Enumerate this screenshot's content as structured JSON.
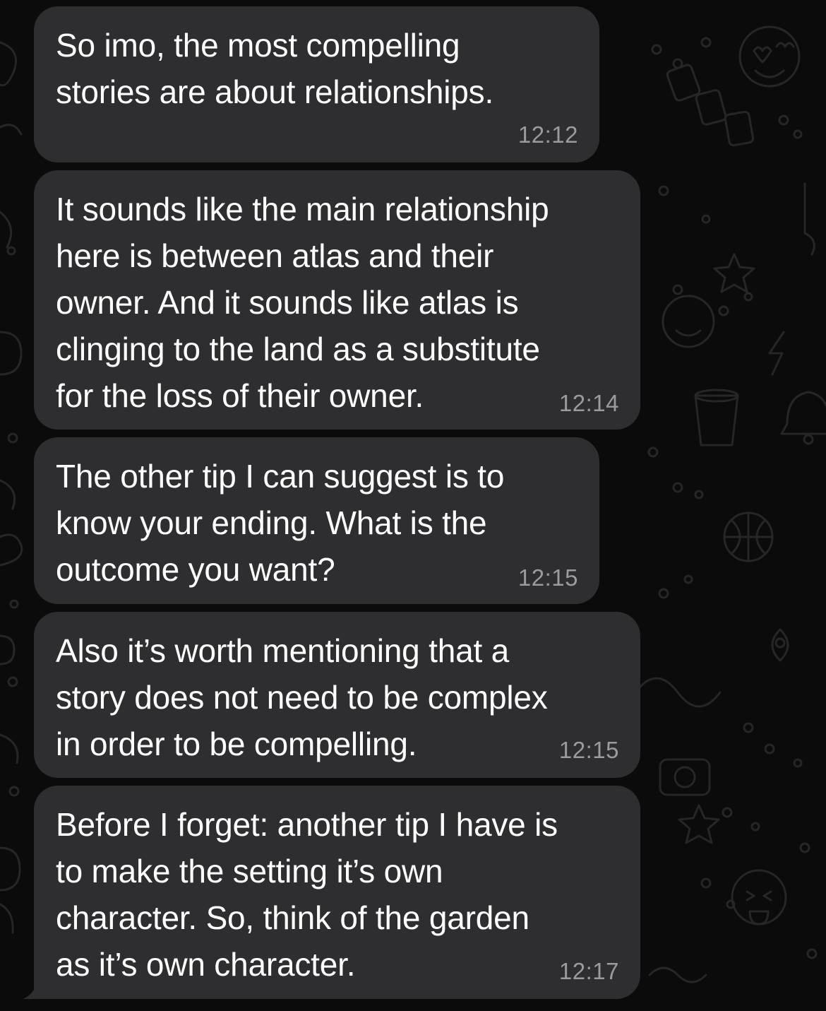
{
  "messages": [
    {
      "text": "So imo, the most compelling\nstories are about relationships.",
      "time": "12:12"
    },
    {
      "text": "It sounds like the main relationship\nhere is between atlas and their\nowner. And it sounds like atlas is\nclinging to the land as a substitute\nfor the loss of their owner.",
      "time": "12:14"
    },
    {
      "text": "The other tip I can suggest is to\nknow your ending. What is the\noutcome you want?",
      "time": "12:15"
    },
    {
      "text": "Also it’s worth mentioning that a\nstory does not need to be complex\nin order to be compelling.",
      "time": "12:15"
    },
    {
      "text": "Before I forget: another tip I have is\nto make the setting it’s own\ncharacter. So, think of the garden\nas it’s own character.",
      "time": "12:17"
    }
  ],
  "theme": {
    "background": "#0b0b0b",
    "bubble": "#2e2e30",
    "text": "#ffffff",
    "timestamp": "#9b9b9e",
    "doodle": "#2a2a2a"
  }
}
